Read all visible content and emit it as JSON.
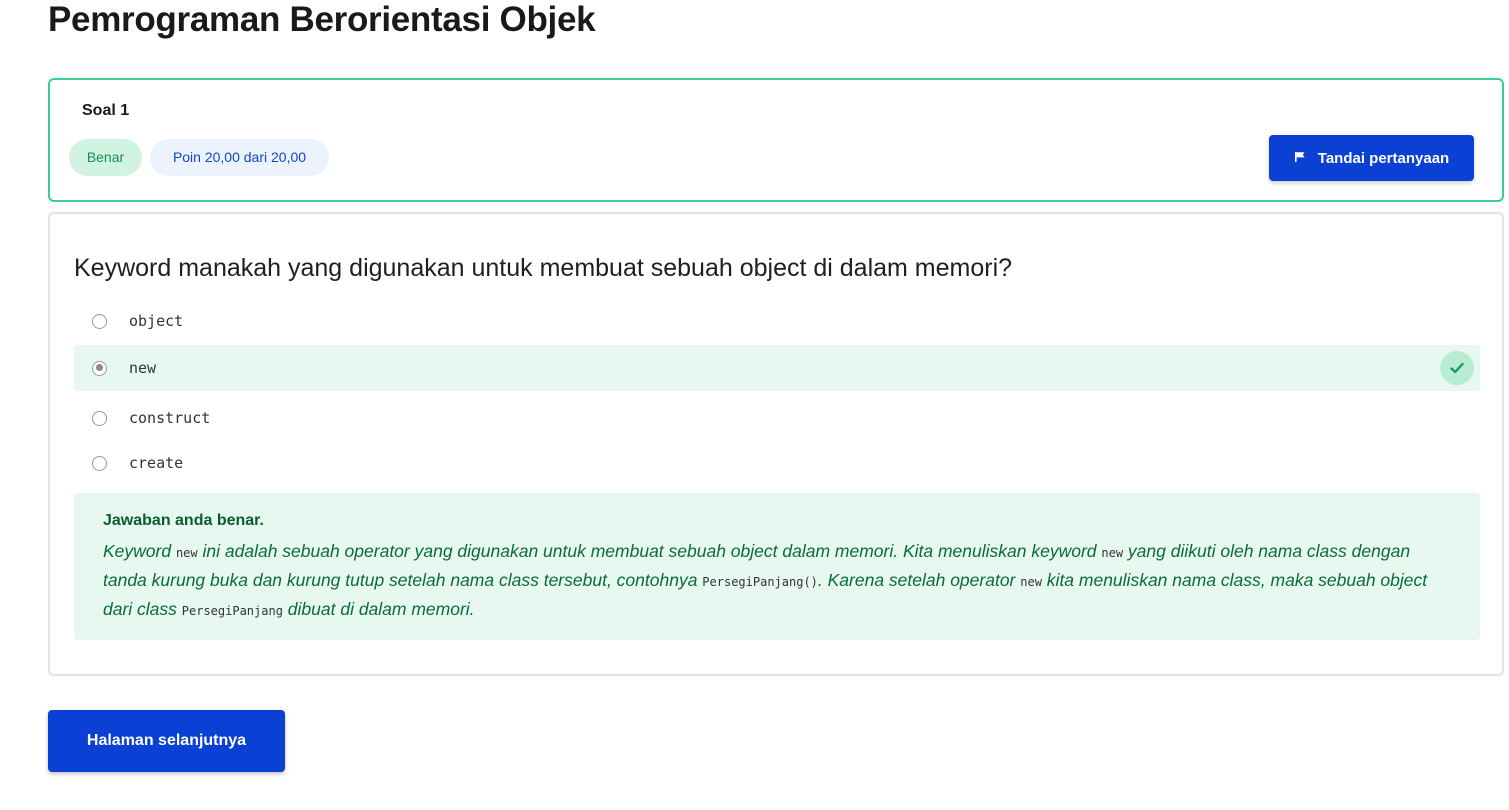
{
  "page": {
    "title": "Pemrograman Berorientasi Objek"
  },
  "question_header": {
    "number_label": "Soal 1",
    "status_badge": "Benar",
    "points_badge": "Poin 20,00 dari 20,00",
    "flag_button_label": "Tandai pertanyaan"
  },
  "question": {
    "text": "Keyword manakah yang digunakan untuk membuat sebuah object di dalam memori?",
    "options": [
      {
        "label": "object",
        "selected": false
      },
      {
        "label": "new",
        "selected": true,
        "correct": true
      },
      {
        "label": "construct",
        "selected": false
      },
      {
        "label": "create",
        "selected": false
      }
    ]
  },
  "feedback": {
    "title": "Jawaban anda benar.",
    "body_parts": [
      "Keyword ",
      "new",
      " ini adalah sebuah operator yang digunakan untuk membuat sebuah object dalam memori. Kita menuliskan keyword ",
      "new",
      " yang diikuti oleh nama class dengan tanda kurung buka dan kurung tutup setelah nama class tersebut, contohnya ",
      "PersegiPanjang()",
      ". Karena setelah operator ",
      "new",
      " kita menuliskan nama class, maka sebuah object dari class ",
      "PersegiPanjang",
      " dibuat di dalam memori."
    ]
  },
  "navigation": {
    "next_button_label": "Halaman selanjutnya"
  },
  "colors": {
    "accent": "#0b40d4",
    "correct_border": "#3ecf8e",
    "correct_bg": "#e6f8ef",
    "correct_text": "#0b6b3a"
  },
  "icons": {
    "flag": "flag-icon",
    "check": "check-icon"
  }
}
